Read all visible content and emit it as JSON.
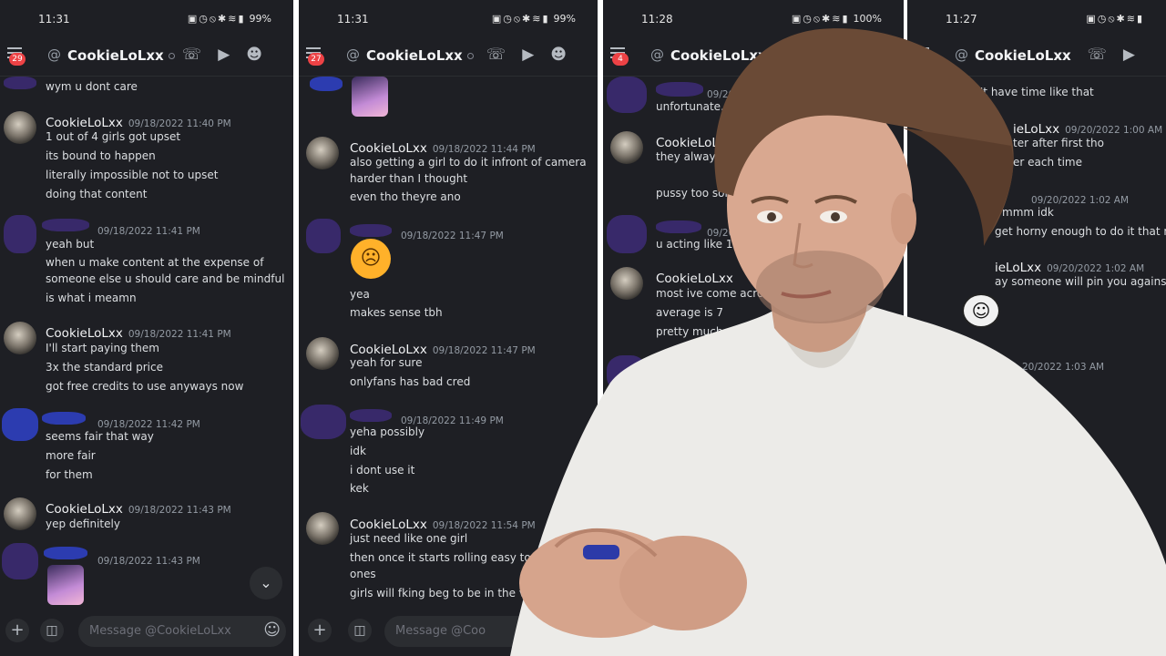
{
  "panels": [
    {
      "status_time": "11:31",
      "battery": "99%",
      "badge": "29",
      "contact": "CookieLoLxx",
      "input_placeholder": "Message @CookieLoLxx",
      "messages": [
        {
          "text": "wym u dont care"
        },
        {
          "author": "CookieLoLxx",
          "time": "09/18/2022 11:40 PM",
          "lines": [
            "1 out of 4 girls got upset",
            "its bound to happen",
            "literally impossible not to upset",
            "doing that content"
          ]
        },
        {
          "time": "09/18/2022 11:41 PM",
          "lines": [
            "yeah but",
            "when u make content at the expense of",
            "someone else u should care and be mindful",
            "is what i meamn"
          ]
        },
        {
          "author": "CookieLoLxx",
          "time": "09/18/2022 11:41 PM",
          "lines": [
            "I'll start paying them",
            "3x the standard price",
            "got free credits to use anyways now"
          ]
        },
        {
          "time": "09/18/2022 11:42 PM",
          "lines": [
            "seems fair that way",
            "more fair",
            "for them"
          ]
        },
        {
          "author": "CookieLoLxx",
          "time": "09/18/2022 11:43 PM",
          "lines": [
            "yep definitely"
          ]
        },
        {
          "time": "09/18/2022 11:43 PM",
          "lines": []
        }
      ]
    },
    {
      "status_time": "11:31",
      "battery": "99%",
      "badge": "27",
      "contact": "CookieLoLxx",
      "input_placeholder": "Message @Coo",
      "messages": [
        {
          "author": "CookieLoLxx",
          "time": "09/18/2022 11:44 PM",
          "lines": [
            "also getting a girl to do it infront of camera",
            "harder than I thought",
            "even tho theyre ano"
          ]
        },
        {
          "time": "09/18/2022 11:47 PM",
          "lines": [
            "yea",
            "makes sense tbh"
          ]
        },
        {
          "author": "CookieLoLxx",
          "time": "09/18/2022 11:47 PM",
          "lines": [
            "yeah for sure",
            "onlyfans has bad cred"
          ]
        },
        {
          "time": "09/18/2022 11:49 PM",
          "lines": [
            "yeha possibly",
            "idk",
            "i dont use it",
            "kek"
          ]
        },
        {
          "author": "CookieLoLxx",
          "time": "09/18/2022 11:54 PM",
          "lines": [
            "just need like one girl",
            "then once it starts rolling easy to get oth",
            "ones",
            "girls will fking beg to be in the vid"
          ]
        }
      ]
    },
    {
      "status_time": "11:28",
      "battery": "100%",
      "badge": "4",
      "contact": "CookieLoLxx",
      "messages": [
        {
          "time": "09/20",
          "lines": [
            "unfortunate..."
          ]
        },
        {
          "author": "CookieLoL",
          "lines": [
            "they always",
            "pussy too sor"
          ]
        },
        {
          "time": "09/20",
          "lines": [
            "u acting like 10-20"
          ]
        },
        {
          "author": "CookieLoLxx",
          "lines": [
            "most ive come acro",
            "average is 7",
            "pretty much every gi"
          ]
        }
      ]
    },
    {
      "status_time": "11:27",
      "badge": "3",
      "contact": "CookieLoLxx",
      "messages": [
        {
          "lines": [
            "'t have time like that"
          ]
        },
        {
          "author": "ieLoLxx",
          "time": "09/20/2022 1:00 AM",
          "lines": [
            "ter after first tho",
            "er each time"
          ]
        },
        {
          "time": "09/20/2022 1:02 AM",
          "lines": [
            "mmm idk",
            "get horny enough to do it that muc"
          ]
        },
        {
          "author": "ieLoLxx",
          "time": "09/20/2022 1:02 AM",
          "lines": [
            "ay someone will pin you against the"
          ]
        },
        {
          "time": "20/2022 1:03 AM",
          "lines": []
        }
      ]
    }
  ],
  "colors": {
    "background": "#1e1f24",
    "badge": "#ed4245",
    "text": "#dbdee1",
    "timestamp": "#949ba4"
  },
  "icons": [
    "menu-icon",
    "at-icon",
    "call-icon",
    "video-icon",
    "members-icon",
    "plus-icon",
    "gift-icon",
    "emoji-icon",
    "chevron-down-icon"
  ]
}
